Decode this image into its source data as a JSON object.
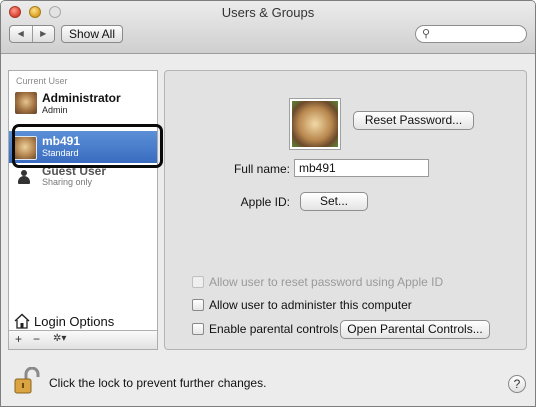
{
  "window": {
    "title": "Users & Groups"
  },
  "toolbar": {
    "back_glyph": "◀",
    "forward_glyph": "▶",
    "show_all_label": "Show All",
    "search_placeholder": ""
  },
  "sidebar": {
    "current_user_heading": "Current User",
    "current_user": {
      "name": "Administrator",
      "role": "Admin"
    },
    "selected_user": {
      "name": "mb491",
      "role": "Standard"
    },
    "guest_user": {
      "name": "Guest User",
      "role": "Sharing only"
    },
    "login_options_label": "Login Options",
    "tools": {
      "add": "+",
      "remove": "−",
      "action": "✲▾"
    }
  },
  "panel": {
    "reset_password_label": "Reset Password...",
    "full_name_label": "Full name:",
    "full_name_value": "mb491",
    "apple_id_label": "Apple ID:",
    "set_button_label": "Set...",
    "allow_reset_label": "Allow user to reset password using Apple ID",
    "allow_admin_label": "Allow user to administer this computer",
    "parental_label": "Enable parental controls",
    "open_parental_label": "Open Parental Controls..."
  },
  "footer": {
    "lock_text": "Click the lock to prevent further changes.",
    "help_glyph": "?"
  },
  "colors": {
    "selection": "#3a6cc0",
    "highlight_border": "#0a0a0a"
  }
}
